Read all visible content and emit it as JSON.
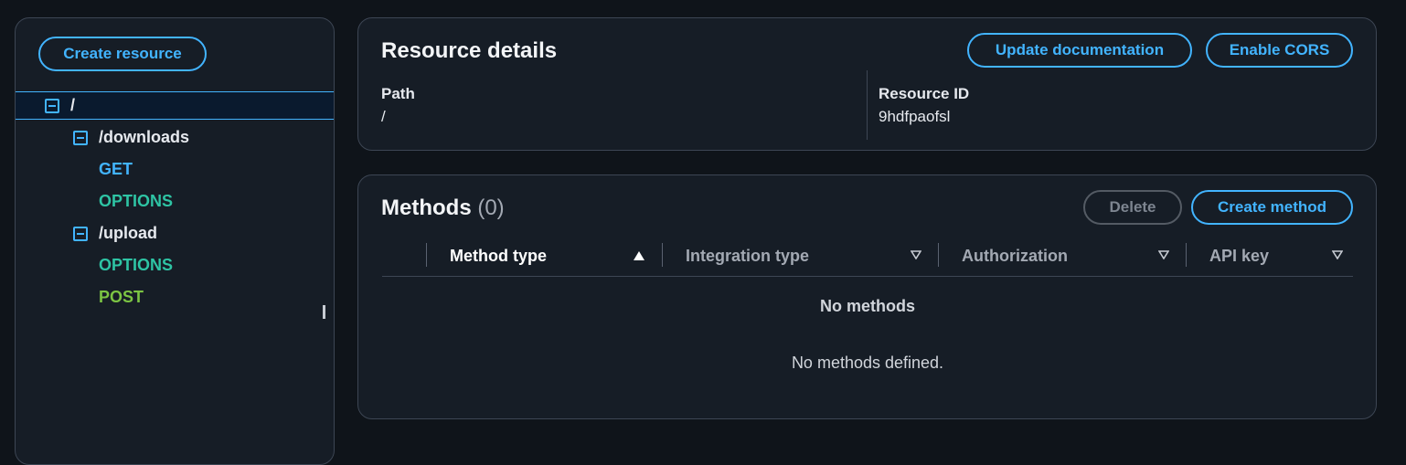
{
  "sidebar": {
    "create_resource_label": "Create resource",
    "tree": [
      {
        "label": "/",
        "kind": "resource"
      },
      {
        "label": "/downloads",
        "kind": "resource"
      },
      {
        "label": "GET",
        "kind": "method"
      },
      {
        "label": "OPTIONS",
        "kind": "method"
      },
      {
        "label": "/upload",
        "kind": "resource"
      },
      {
        "label": "OPTIONS",
        "kind": "method"
      },
      {
        "label": "POST",
        "kind": "method"
      }
    ]
  },
  "resource_details": {
    "title": "Resource details",
    "update_documentation_label": "Update documentation",
    "enable_cors_label": "Enable CORS",
    "path_label": "Path",
    "path_value": "/",
    "resource_id_label": "Resource ID",
    "resource_id_value": "9hdfpaofsl"
  },
  "methods": {
    "title": "Methods",
    "count": "(0)",
    "delete_label": "Delete",
    "create_method_label": "Create method",
    "columns": [
      "Method type",
      "Integration type",
      "Authorization",
      "API key"
    ],
    "sorted_column": "Method type",
    "sort_direction": "ascending",
    "empty_title": "No methods",
    "empty_text": "No methods defined."
  },
  "colors": {
    "accent": "#42b4ff",
    "get": "#42b4ff",
    "options": "#2ec4a4",
    "post": "#7cc543",
    "background": "#0f141a",
    "panel": "#161d26"
  }
}
